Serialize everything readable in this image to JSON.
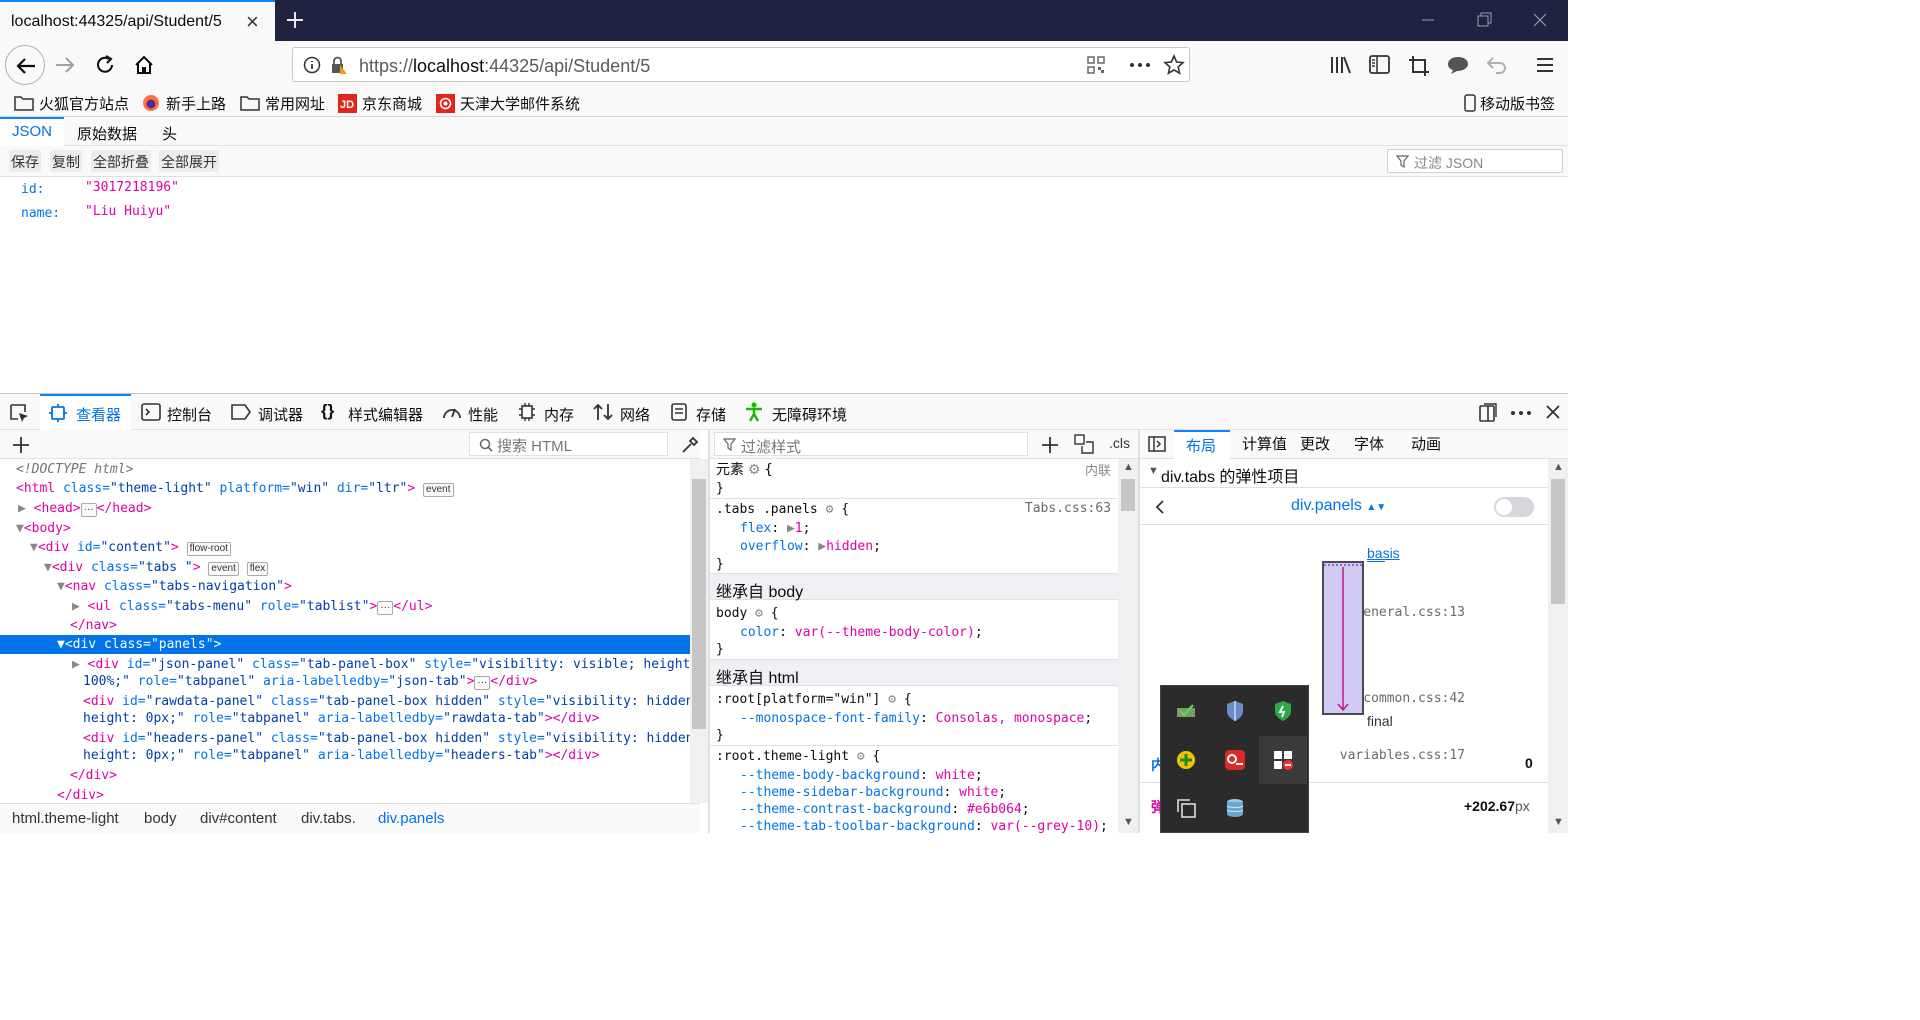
{
  "browser": {
    "tab_title": "localhost:44325/api/Student/5",
    "tab_close": "×",
    "url_scheme": "https://",
    "url_host": "localhost",
    "url_rest": ":44325/api/Student/5",
    "bookmarks": [
      "火狐官方站点",
      "新手上路",
      "常用网址",
      "京东商城",
      "天津大学邮件系统"
    ],
    "mobile_bookmarks": "移动版书签"
  },
  "json_viewer": {
    "tabs": [
      "JSON",
      "原始数据",
      "头"
    ],
    "active_tab": "JSON",
    "buttons": [
      "保存",
      "复制",
      "全部折叠",
      "全部展开"
    ],
    "filter_placeholder": "过滤 JSON",
    "rows": [
      {
        "key": "id:",
        "value": "\"3017218196\""
      },
      {
        "key": "name:",
        "value": "\"Liu Huiyu\""
      }
    ]
  },
  "devtools": {
    "tabs": [
      "查看器",
      "控制台",
      "调试器",
      "样式编辑器",
      "性能",
      "内存",
      "网络",
      "存储",
      "无障碍环境"
    ],
    "active_tab": "查看器",
    "search_placeholder": "搜索 HTML",
    "styles_filter_placeholder": "过滤样式",
    "cls_label": ".cls",
    "breadcrumbs": [
      "html.theme-light",
      "body",
      "div#content",
      "div.tabs.",
      "div.panels"
    ],
    "layout_tabs": [
      "布局",
      "计算值",
      "更改",
      "字体",
      "动画"
    ],
    "layout_active": "布局",
    "flex_section_title": "div.tabs 的弹性项目",
    "flex_item_select": "div.panels",
    "flex_basis_label": "basis",
    "flex_final_label": "final",
    "flex_value_1": "0",
    "flex_value_2": "+202.67",
    "flex_value_2_unit": "px",
    "rules": {
      "element_label": "元素",
      "inline_label": "内联",
      "r1_selector": ".tabs .panels",
      "r1_source": "Tabs.css:63",
      "r1_p1": "flex",
      "r1_v1": "1",
      "r1_p2": "overflow",
      "r1_v2": "hidden",
      "inherit_body": "继承自 body",
      "r2_selector": "body",
      "r2_source": "general.css:13",
      "r2_p1": "color",
      "r2_v1": "var(--theme-body-color)",
      "inherit_html": "继承自 html",
      "r3_selector": ":root[platform=\"win\"]",
      "r3_source": "common.css:42",
      "r3_p1": "--monospace-font-family",
      "r3_v1": "Consolas, monospace",
      "r4_selector": ":root.theme-light",
      "r4_source": "variables.css:17",
      "r4_props": [
        {
          "p": "--theme-body-background",
          "v": "white"
        },
        {
          "p": "--theme-sidebar-background",
          "v": "white"
        },
        {
          "p": "--theme-contrast-background",
          "v": "#e6b064"
        },
        {
          "p": "--theme-tab-toolbar-background",
          "v": "var(--grey-10)"
        }
      ]
    }
  },
  "colors": {
    "accent": "#0a84ff",
    "titlebar": "#202340",
    "selection": "#0074e8",
    "tag": "#dd00a9",
    "attr": "#0074e8"
  }
}
